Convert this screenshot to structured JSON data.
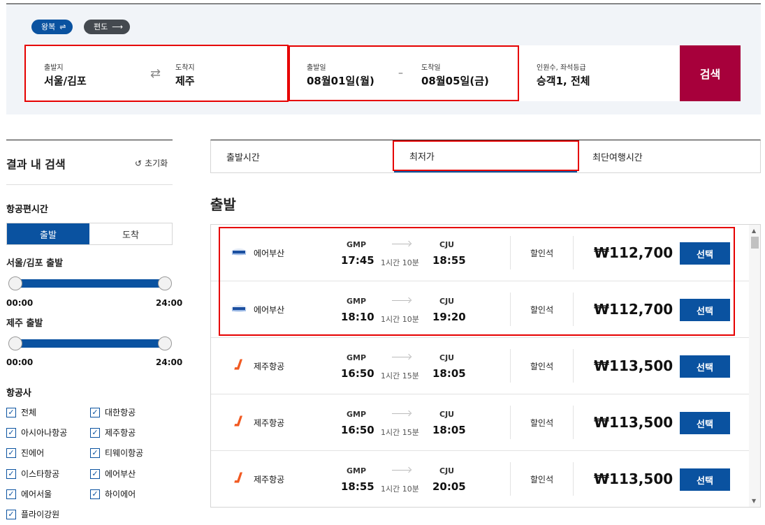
{
  "trip_type": {
    "round": {
      "label": "왕복",
      "icon": "swap-arrows-icon"
    },
    "oneway": {
      "label": "편도",
      "icon": "right-arrow-icon"
    }
  },
  "route": {
    "from_label": "출발지",
    "from_value": "서울/김포",
    "to_label": "도착지",
    "to_value": "제주"
  },
  "dates": {
    "dep_label": "출발일",
    "dep_value": "08월01일(월)",
    "dash": "–",
    "arr_label": "도착일",
    "arr_value": "08월05일(금)"
  },
  "pax": {
    "label": "인원수, 좌석등급",
    "value": "승객1, 전체"
  },
  "search_button": "검색",
  "sidebar": {
    "title": "결과 내 검색",
    "reset": "초기화",
    "time_section": "항공편시간",
    "seg_dep": "출발",
    "seg_arr": "도착",
    "slider1_label": "서울/김포 출발",
    "slider2_label": "제주 출발",
    "tick_min": "00:00",
    "tick_max": "24:00",
    "airline_section": "항공사",
    "airlines": [
      "전체",
      "대한항공",
      "아시아나항공",
      "제주항공",
      "진에어",
      "티웨이항공",
      "이스타항공",
      "에어부산",
      "에어서울",
      "하이에어",
      "플라이강원"
    ]
  },
  "sort_tabs": [
    "출발시간",
    "최저가",
    "최단여행시간"
  ],
  "section_heading": "출발",
  "colors": {
    "primary": "#0a52a0",
    "search": "#a7003b",
    "highlight": "#e60000"
  },
  "flights": [
    {
      "airline": "에어부산",
      "logo": "airbusan-logo",
      "from": "GMP",
      "dep": "17:45",
      "duration": "1시간 10분",
      "to": "CJU",
      "arr": "18:55",
      "seat": "할인석",
      "price": "₩112,700",
      "btn": "선택"
    },
    {
      "airline": "에어부산",
      "logo": "airbusan-logo",
      "from": "GMP",
      "dep": "18:10",
      "duration": "1시간 10분",
      "to": "CJU",
      "arr": "19:20",
      "seat": "할인석",
      "price": "₩112,700",
      "btn": "선택"
    },
    {
      "airline": "제주항공",
      "logo": "jejuair-logo",
      "from": "GMP",
      "dep": "16:50",
      "duration": "1시간 15분",
      "to": "CJU",
      "arr": "18:05",
      "seat": "할인석",
      "price": "₩113,500",
      "btn": "선택"
    },
    {
      "airline": "제주항공",
      "logo": "jejuair-logo",
      "from": "GMP",
      "dep": "16:50",
      "duration": "1시간 15분",
      "to": "CJU",
      "arr": "18:05",
      "seat": "할인석",
      "price": "₩113,500",
      "btn": "선택"
    },
    {
      "airline": "제주항공",
      "logo": "jejuair-logo",
      "from": "GMP",
      "dep": "18:55",
      "duration": "1시간 10분",
      "to": "CJU",
      "arr": "20:05",
      "seat": "할인석",
      "price": "₩113,500",
      "btn": "선택"
    }
  ]
}
